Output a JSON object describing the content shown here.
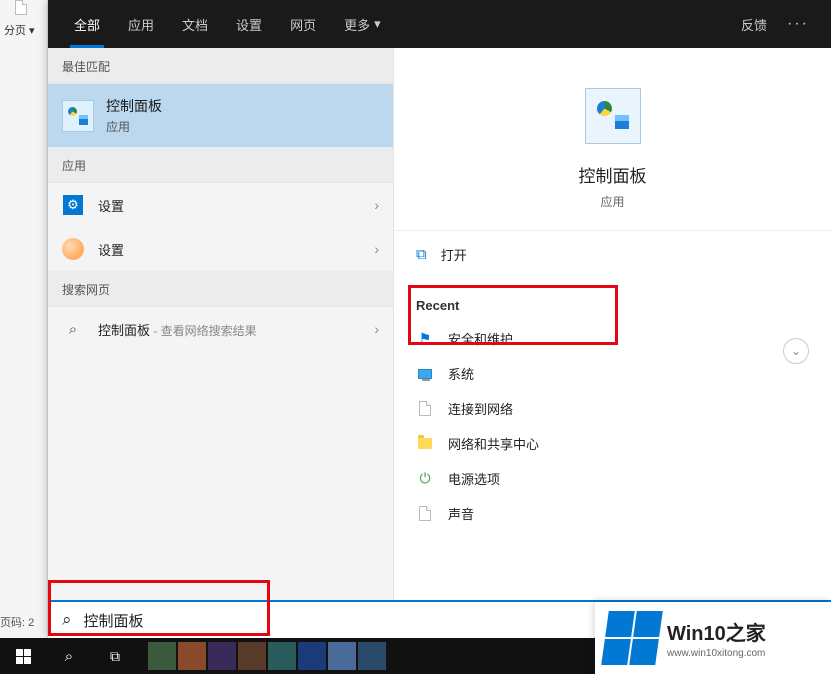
{
  "bg": {
    "splitLabel": "分页 ▾",
    "pageLabel": "页码: 2"
  },
  "tabs": {
    "items": [
      "全部",
      "应用",
      "文档",
      "设置",
      "网页"
    ],
    "more": "更多",
    "feedback": "反馈"
  },
  "left": {
    "bestMatchHeader": "最佳匹配",
    "bestMatch": {
      "title": "控制面板",
      "sub": "应用"
    },
    "appsHeader": "应用",
    "apps": [
      {
        "label": "设置"
      },
      {
        "label": "设置"
      }
    ],
    "webHeader": "搜索网页",
    "web": {
      "term": "控制面板",
      "suffix": " - 查看网络搜索结果"
    }
  },
  "right": {
    "heroTitle": "控制面板",
    "heroSub": "应用",
    "open": "打开",
    "recentHeader": "Recent",
    "recent": [
      "安全和维护",
      "系统",
      "连接到网络",
      "网络和共享中心",
      "电源选项",
      "声音"
    ]
  },
  "search": {
    "value": "控制面板"
  },
  "watermark": {
    "brand1": "Win10",
    "brand2": "之家",
    "url": "www.win10xitong.com"
  }
}
